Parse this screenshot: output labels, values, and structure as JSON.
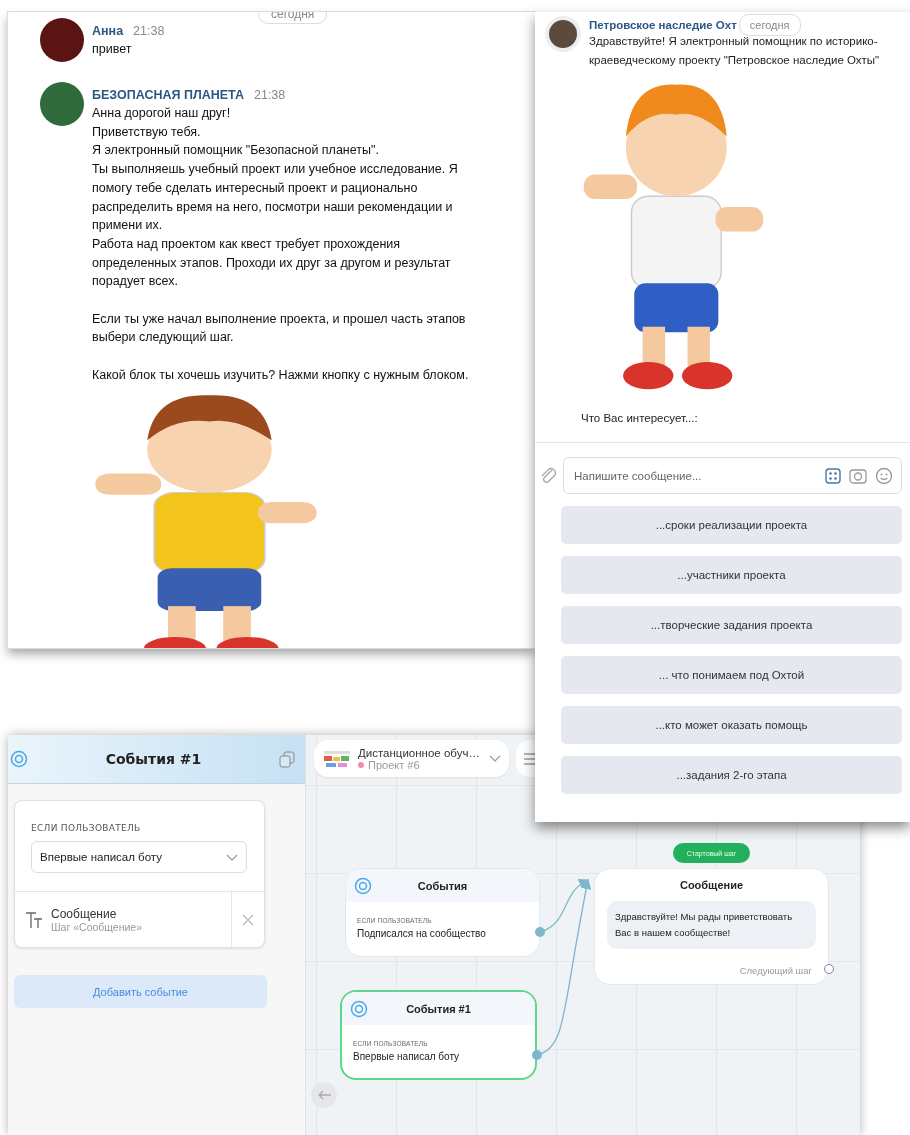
{
  "chat_left": {
    "date_badge": "сегодня",
    "messages": [
      {
        "author": "Анна",
        "time": "21:38",
        "text": "привет"
      },
      {
        "author": "БЕЗОПАСНАЯ ПЛАНЕТА",
        "time": "21:38",
        "text": "Анна дорогой наш друг!\nПриветствую тебя.\nЯ электронный помощник \"Безопасной планеты\".\nТы выполняешь учебный проект или учебное исследование. Я помогу тебе сделать интересный проект и рационально распределить время на него, посмотри наши рекомендации и примени их.\nРабота над проектом как квест требует прохождения определенных этапов. Проходи их друг за другом и результат порадует всех.\n\nЕсли ты уже начал выполнение проекта, и прошел часть этапов выбери следующий шаг.\n\nКакой блок ты хочешь изучить? Нажми кнопку с нужным блоком."
      }
    ]
  },
  "chat_right": {
    "author": "Петровское наследие Охт",
    "date_badge": "сегодня",
    "text": "Здравствуйте! Я электронный помощник по историко-краеведческому проекту \"Петровское наследие Охты\"",
    "prompt": "Что Вас интересует...:",
    "composer": {
      "placeholder": "Напишите сообщение..."
    },
    "quick_replies": [
      "...сроки реализации проекта",
      "...участники проекта",
      "...творческие задания проекта",
      "... что понимаем под Охтой",
      "...кто может оказать помощь",
      "...задания 2-го этапа"
    ]
  },
  "builder": {
    "panel": {
      "title": "События #1",
      "condition_label": "ЕСЛИ ПОЛЬЗОВАТЕЛЬ",
      "condition_value": "Впервые написал боту",
      "step": {
        "title": "Сообщение",
        "subtitle": "Шаг «Сообщение»"
      },
      "add_button": "Добавить событие"
    },
    "project": {
      "name": "Дистанционное обуч…",
      "label": "Проект #6"
    },
    "nodes": [
      {
        "kind": "event",
        "title": "События",
        "caption": "ЕСЛИ ПОЛЬЗОВАТЕЛЬ",
        "value": "Подписался на сообщество",
        "selected": false
      },
      {
        "kind": "event",
        "title": "События #1",
        "caption": "ЕСЛИ ПОЛЬЗОВАТЕЛЬ",
        "value": "Впервые написал боту",
        "selected": true
      },
      {
        "kind": "message",
        "badge": "Стартовый шаг",
        "title": "Сообщение",
        "text": "Здравствуйте! Мы рады приветствовать Вас в нашем сообществе!",
        "next": "Следующий шаг",
        "selected": false
      }
    ]
  }
}
